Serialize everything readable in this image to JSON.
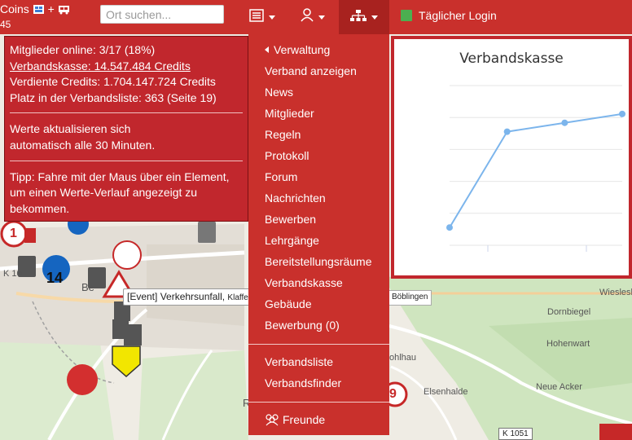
{
  "navbar": {
    "coins_label": "Coins",
    "coins_plus": "+",
    "coins_sub": "45",
    "search_placeholder": "Ort suchen...",
    "login_label": "Täglicher Login"
  },
  "info_panel": {
    "members_online": "Mitglieder online: 3/17 (18%)",
    "treasury": "Verbandskasse: 14.547.484 Credits",
    "earned": "Verdiente Credits: 1.704.147.724 Credits",
    "rank": "Platz in der Verbandsliste: 363 (Seite 19)",
    "refresh_line1": "Werte aktualisieren sich",
    "refresh_line2": "automatisch alle 30 Minuten.",
    "tip_line1": "Tipp: Fahre mit der Maus über ein Element,",
    "tip_line2": "um einen Werte-Verlauf angezeigt zu",
    "tip_line3": "bekommen."
  },
  "dropdown": {
    "back": "Verwaltung",
    "items": [
      "Verband anzeigen",
      "News",
      "Mitglieder",
      "Regeln",
      "Protokoll",
      "Forum",
      "Nachrichten",
      "Bewerben",
      "Lehrgänge",
      "Bereitstellungsräume",
      "Verbandskasse",
      "Gebäude",
      "Bewerbung (0)"
    ],
    "lists": [
      "Verbandsliste",
      "Verbandsfinder"
    ],
    "friends": "Freunde"
  },
  "chart_data": {
    "type": "line",
    "title": "Verbandskasse",
    "x": [
      0,
      1,
      2,
      3
    ],
    "series": [
      {
        "values": [
          1.0,
          6.4,
          6.9,
          7.4
        ]
      }
    ],
    "ylim": [
      0,
      9
    ],
    "grid": true,
    "color": "#7cb5ec"
  },
  "map": {
    "tooltip_event": "[Event] Verkehrsunfall,",
    "tooltip_rest": "Klaffe",
    "place": "Böblingen",
    "labels": [
      "Wieslesh",
      "Dornbiegel",
      "Hohenwart",
      "Neue Acker",
      "Elsenhalde",
      "ohlhau",
      "Be",
      "K 10",
      "R"
    ],
    "roads": [
      "K 1051"
    ],
    "numbers": [
      "1",
      "14",
      "9"
    ]
  },
  "colors": {
    "navbar": "#c9302c",
    "panel": "#c1272d",
    "accent_dark": "#a8221f",
    "series": "#7cb5ec"
  }
}
